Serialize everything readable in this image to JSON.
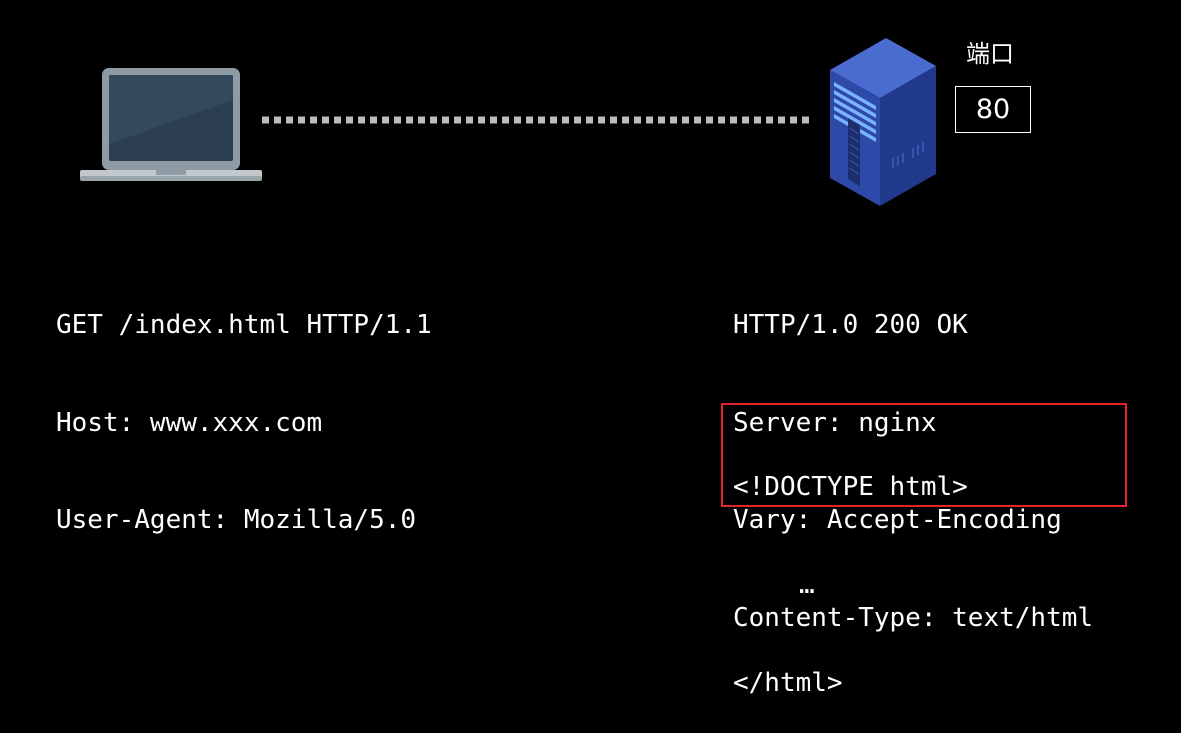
{
  "client": {
    "icon": "laptop-icon"
  },
  "server": {
    "icon": "server-icon",
    "port_label": "端口",
    "port_value": "80"
  },
  "connection": {
    "style": "dotted",
    "color": "#b8bcc0"
  },
  "request": {
    "lines": [
      "GET /index.html HTTP/1.1",
      "Host: www.xxx.com",
      "User-Agent: Mozilla/5.0"
    ]
  },
  "response": {
    "header_lines": [
      "HTTP/1.0 200 OK",
      "Server: nginx",
      "Vary: Accept-Encoding",
      "Content-Type: text/html"
    ],
    "body_lines": [
      "<!DOCTYPE html>",
      "…",
      "</html>"
    ],
    "body_highlight_color": "#e0242a"
  }
}
